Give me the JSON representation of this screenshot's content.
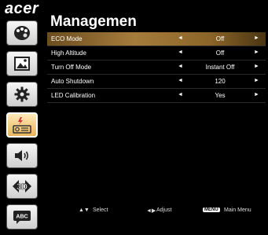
{
  "brand": "acer",
  "header": {
    "title": "Managemen"
  },
  "sidebar": {
    "items": [
      {
        "icon": "palette-icon"
      },
      {
        "icon": "picture-icon"
      },
      {
        "icon": "gear-icon"
      },
      {
        "icon": "power-management-icon",
        "active": true
      },
      {
        "icon": "speaker-icon"
      },
      {
        "icon": "3d-icon",
        "label": "3D"
      },
      {
        "icon": "language-icon",
        "label": "ABC"
      }
    ]
  },
  "menu": {
    "rows": [
      {
        "label": "ECO Mode",
        "value": "Off",
        "selected": true
      },
      {
        "label": "High Altitude",
        "value": "Off"
      },
      {
        "label": "Turn Off Mode",
        "value": "Instant Off"
      },
      {
        "label": "Auto Shutdown",
        "value": "120"
      },
      {
        "label": "LED Calibration",
        "value": "Yes"
      }
    ],
    "left_arrow": "◄",
    "right_arrow": "►"
  },
  "footer": {
    "select_glyph": "▲▼",
    "select_label": "Select",
    "adjust_glyph": "◄▶",
    "adjust_label": "Adjust",
    "menu_key": "MENU",
    "menu_label": "Main Menu"
  }
}
